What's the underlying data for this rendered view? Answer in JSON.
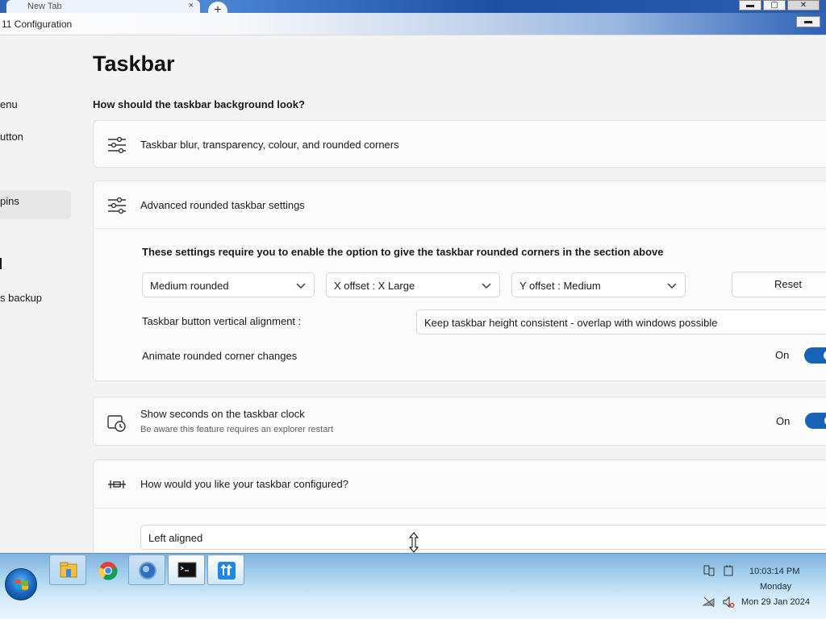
{
  "browser": {
    "tab_title": "New Tab",
    "tab_close": "×",
    "new_tab": "+"
  },
  "window": {
    "title": "11 Configuration",
    "min": "▬",
    "max": "▢",
    "close": "✕"
  },
  "sidebar": {
    "items": [
      {
        "label": "enu"
      },
      {
        "label": "utton"
      },
      {
        "label": ""
      },
      {
        "label": " pins"
      },
      {
        "label": ""
      },
      {
        "label": ""
      },
      {
        "label": "s backup"
      }
    ]
  },
  "main": {
    "title": "Taskbar",
    "question": "How should the taskbar background look?",
    "card_blur": {
      "label": "Taskbar blur, transparency, colour, and rounded corners"
    },
    "card_advanced": {
      "label": "Advanced rounded taskbar settings",
      "note": "These settings require you to enable the option to give the taskbar rounded corners in the section above",
      "rounding": "Medium rounded",
      "x_offset": "X offset : X Large",
      "y_offset": "Y offset : Medium",
      "reset": "Reset",
      "alignment_label": "Taskbar button vertical alignment :",
      "alignment_value": "Keep taskbar height consistent - overlap with windows possible",
      "animate_label": "Animate rounded corner changes",
      "animate_state": "On"
    },
    "card_seconds": {
      "label": "Show seconds on the taskbar clock",
      "sub": "Be aware this feature requires an explorer restart",
      "state": "On"
    },
    "card_config": {
      "label": "How would you like your taskbar configured?",
      "value": "Left aligned"
    }
  },
  "taskbar": {
    "clock_time": "10:03:14 PM",
    "clock_day": "Monday",
    "clock_date": "Mon 29 Jan 2024"
  },
  "colors": {
    "accent": "#1763b8",
    "background": "#f3f3f3",
    "card": "#fbfbfb"
  }
}
